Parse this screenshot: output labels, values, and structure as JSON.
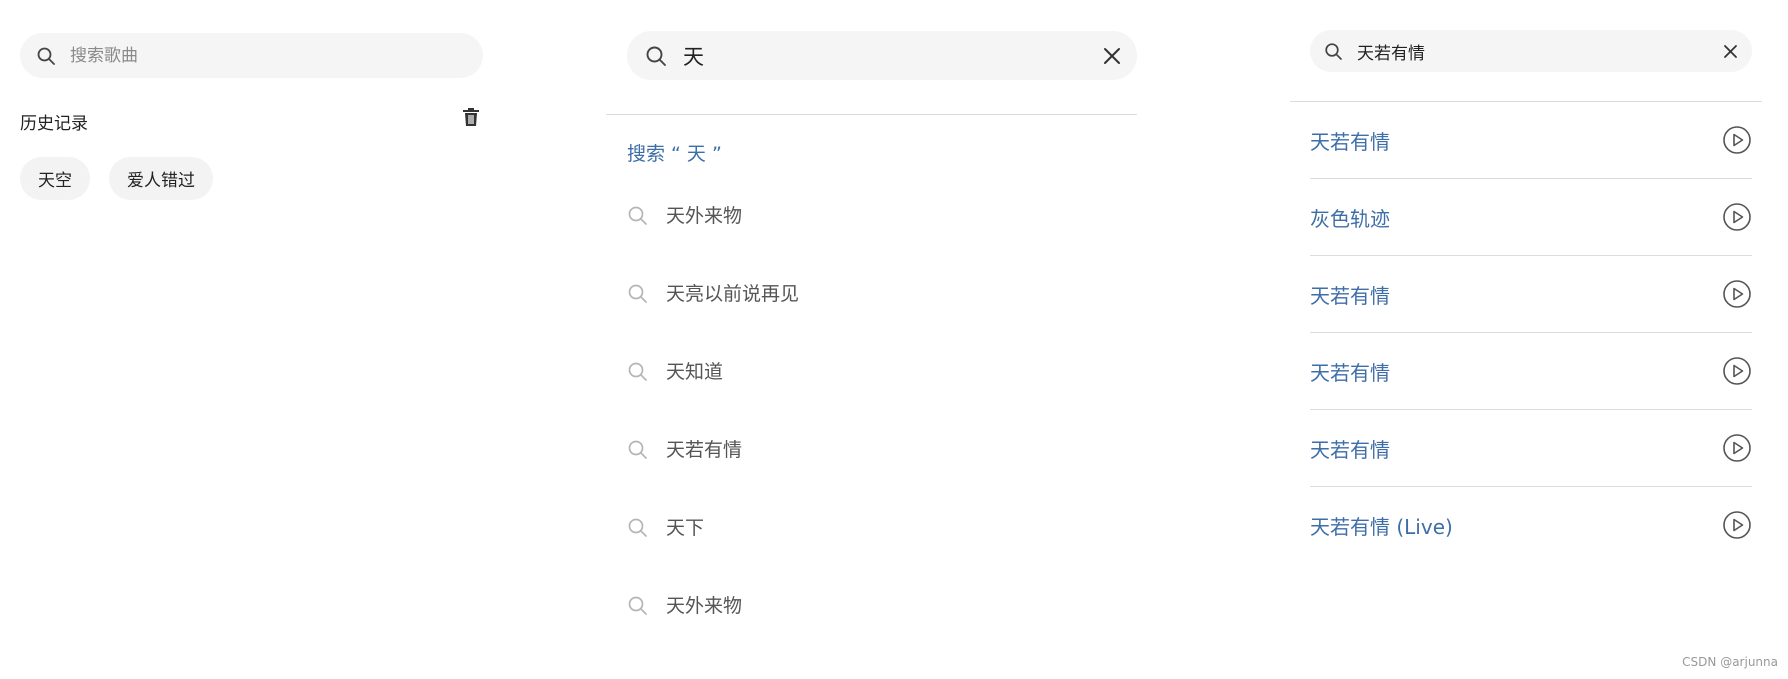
{
  "panel1": {
    "search": {
      "placeholder": "搜索歌曲",
      "value": ""
    },
    "history": {
      "title": "历史记录",
      "tags": [
        "天空",
        "爱人错过"
      ]
    }
  },
  "panel2": {
    "search": {
      "value": "天"
    },
    "search_link": "搜索 “ 天 ”",
    "suggestions": [
      "天外来物",
      "天亮以前说再见",
      "天知道",
      "天若有情",
      "天下",
      "天外来物"
    ]
  },
  "panel3": {
    "search": {
      "value": "天若有情"
    },
    "songs": [
      "天若有情",
      "灰色轨迹",
      "天若有情",
      "天若有情",
      "天若有情",
      "天若有情 (Live)"
    ]
  },
  "watermark": "CSDN @arjunna",
  "colors": {
    "accent": "#3e6ea8",
    "bar_bg": "#f5f5f5",
    "divider": "#dcdcdc"
  },
  "icons": [
    "search-icon",
    "trash-icon",
    "close-icon",
    "play-circle-icon"
  ]
}
